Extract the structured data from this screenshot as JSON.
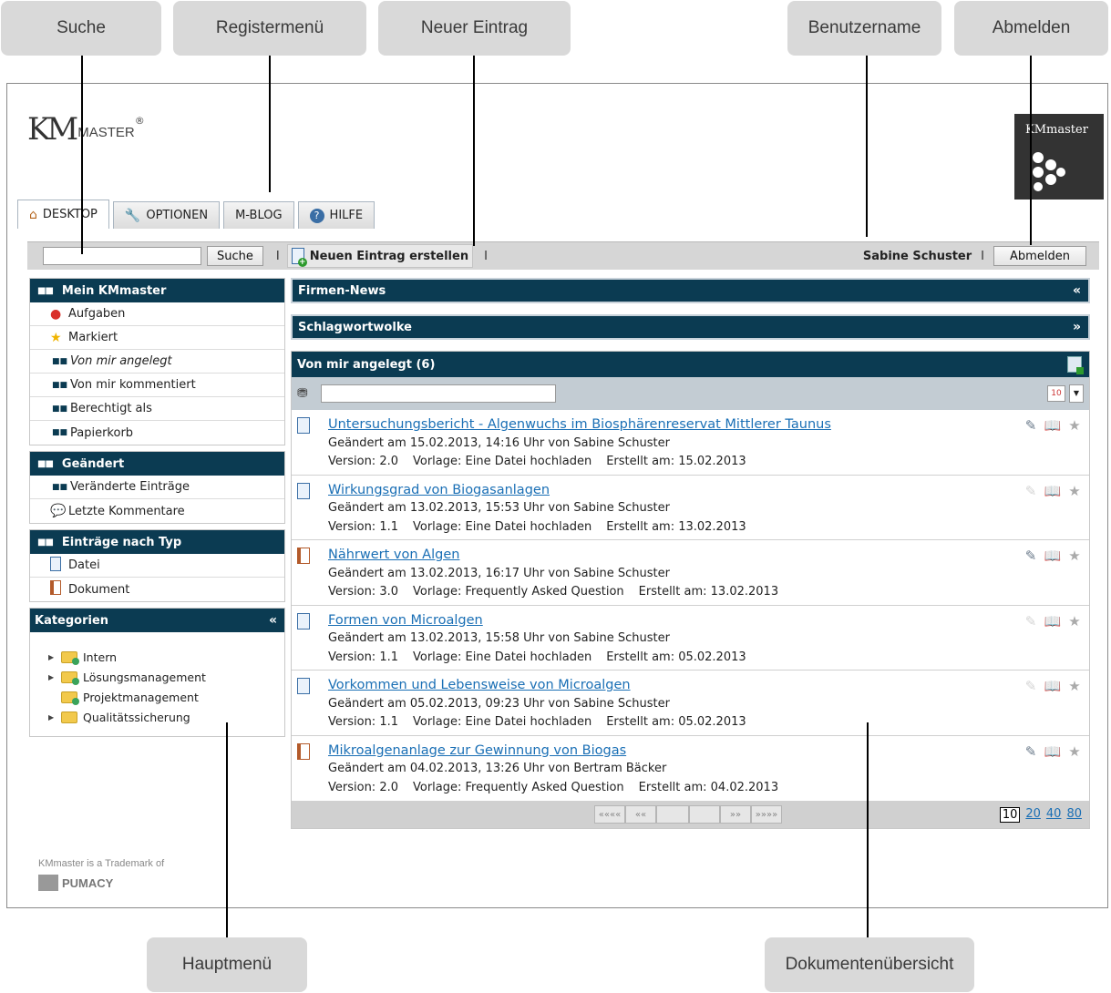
{
  "callouts": {
    "suche": "Suche",
    "registermenue": "Registermenü",
    "neuer_eintrag": "Neuer Eintrag",
    "benutzername": "Benutzername",
    "abmelden": "Abmelden",
    "hauptmenue": "Hauptmenü",
    "dokumentenuebersicht": "Dokumentenübersicht"
  },
  "logo": {
    "km": "KM",
    "master": "MASTER",
    "reg": "®",
    "small": "KMmaster"
  },
  "tabs": [
    {
      "label": "DESKTOP",
      "icon": "home-icon"
    },
    {
      "label": "OPTIONEN",
      "icon": "wrench-icon"
    },
    {
      "label": "M-BLOG"
    },
    {
      "label": "HILFE",
      "icon": "help-icon"
    }
  ],
  "toolbar": {
    "search_value": "",
    "search_button": "Suche",
    "separator": "I",
    "new_entry": "Neuen Eintrag erstellen",
    "username": "Sabine Schuster",
    "logout": "Abmelden"
  },
  "sidebar": {
    "mein": {
      "title": "Mein KMmaster",
      "items": [
        "Aufgaben",
        "Markiert",
        "Von mir angelegt",
        "Von mir kommentiert",
        "Berechtigt als",
        "Papierkorb"
      ]
    },
    "geaendert": {
      "title": "Geändert",
      "items": [
        "Veränderte Einträge",
        "Letzte Kommentare"
      ]
    },
    "typ": {
      "title": "Einträge nach Typ",
      "items": [
        "Datei",
        "Dokument"
      ]
    },
    "kategorien": {
      "title": "Kategorien",
      "collapse": "«",
      "items": [
        "Intern",
        "Lösungsmanagement",
        "Projektmanagement",
        "Qualitätssicherung"
      ]
    }
  },
  "main": {
    "firmen_news": {
      "title": "Firmen-News",
      "arrow": "«"
    },
    "schlagwort": {
      "title": "Schlagwortwolke",
      "arrow": "»"
    },
    "list_title": "Von mir angelegt (6)",
    "filter_value": "",
    "calendar_label": "10",
    "entries": [
      {
        "title": "Untersuchungsbericht - Algenwuchs im Biosphärenreservat Mittlerer Taunus",
        "changed": "Geändert am 15.02.2013, 14:16 Uhr von Sabine Schuster",
        "version": "Version: 2.0",
        "template": "Vorlage: Eine Datei hochladen",
        "created": "Erstellt am: 15.02.2013",
        "type": "file"
      },
      {
        "title": "Wirkungsgrad von Biogasanlagen",
        "changed": "Geändert am 13.02.2013, 15:53 Uhr von Sabine Schuster",
        "version": "Version: 1.1",
        "template": "Vorlage: Eine Datei hochladen",
        "created": "Erstellt am: 13.02.2013",
        "type": "file"
      },
      {
        "title": "Nährwert von Algen",
        "changed": "Geändert am 13.02.2013, 16:17 Uhr von Sabine Schuster",
        "version": "Version: 3.0",
        "template": "Vorlage: Frequently Asked Question",
        "created": "Erstellt am: 13.02.2013",
        "type": "document"
      },
      {
        "title": "Formen von Microalgen",
        "changed": "Geändert am 13.02.2013, 15:58 Uhr von Sabine Schuster",
        "version": "Version: 1.1",
        "template": "Vorlage: Eine Datei hochladen",
        "created": "Erstellt am: 05.02.2013",
        "type": "file"
      },
      {
        "title": "Vorkommen und Lebensweise von Microalgen",
        "changed": "Geändert am 05.02.2013, 09:23 Uhr von Sabine Schuster",
        "version": "Version: 1.1",
        "template": "Vorlage: Eine Datei hochladen",
        "created": "Erstellt am: 05.02.2013",
        "type": "file"
      },
      {
        "title": "Mikroalgenanlage zur Gewinnung von Biogas",
        "changed": "Geändert am 04.02.2013, 13:26 Uhr von Bertram Bäcker",
        "version": "Version: 2.0",
        "template": "Vorlage: Frequently Asked Question",
        "created": "Erstellt am: 04.02.2013",
        "type": "document"
      }
    ],
    "pager": {
      "first": "««««",
      "prev": "««",
      "next": "»»",
      "last": "»»»»",
      "sizes": [
        "10",
        "20",
        "40",
        "80"
      ]
    }
  },
  "footer": {
    "trademark": "KMmaster is a Trademark of",
    "company": "PUMACY"
  }
}
